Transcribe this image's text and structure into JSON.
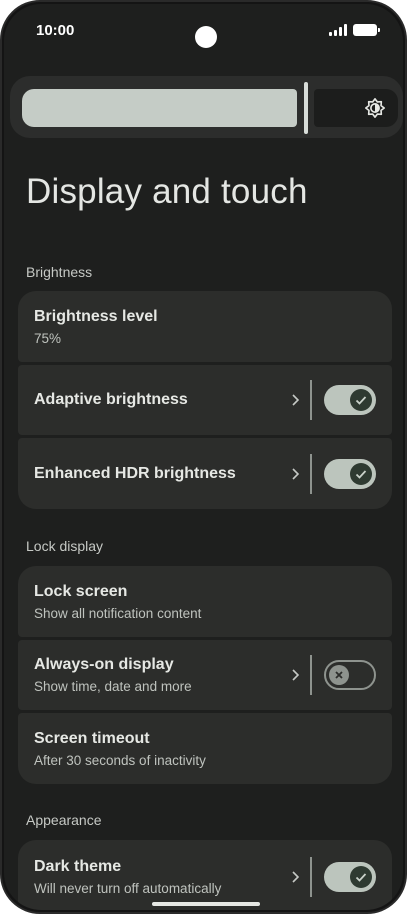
{
  "status": {
    "time": "10:00"
  },
  "page": {
    "title": "Display and touch"
  },
  "sections": {
    "brightness": "Brightness",
    "lock_display": "Lock display",
    "appearance": "Appearance"
  },
  "settings": {
    "brightness_level": {
      "title": "Brightness level",
      "subtitle": "75%"
    },
    "adaptive_brightness": {
      "title": "Adaptive brightness",
      "enabled": true
    },
    "enhanced_hdr": {
      "title": "Enhanced HDR brightness",
      "enabled": true
    },
    "lock_screen": {
      "title": "Lock screen",
      "subtitle": "Show all notification content"
    },
    "always_on": {
      "title": "Always-on display",
      "subtitle": "Show time, date and more",
      "enabled": false
    },
    "screen_timeout": {
      "title": "Screen timeout",
      "subtitle": "After 30 seconds of inactivity"
    },
    "dark_theme": {
      "title": "Dark theme",
      "subtitle": "Will never turn off automatically",
      "enabled": true
    }
  },
  "brightness_slider": {
    "level": 0.75
  },
  "colors": {
    "background": "#1e1f1e",
    "card": "#2c2d2b",
    "toggle_on": "#bcc5bd",
    "toggle_knob_on": "#2e3a31",
    "slider_fill": "#c5ccc6"
  },
  "icons": {
    "brightness": "brightness-auto-icon",
    "chevron": "chevron-right-icon",
    "check": "check-icon",
    "close": "close-icon"
  }
}
